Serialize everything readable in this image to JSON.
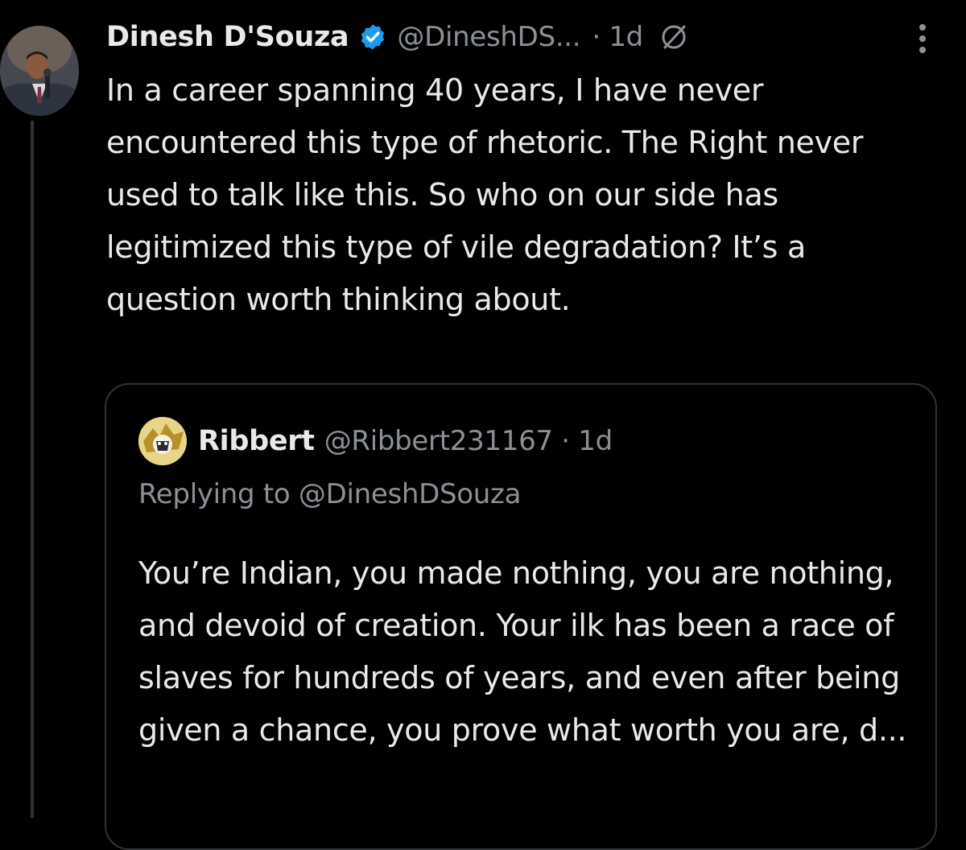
{
  "tweet": {
    "author_name": "Dinesh D'Souza",
    "author_handle": "@DineshDS...",
    "time": "· 1d",
    "icons": {
      "verified": "verified-badge-icon",
      "edited": "edited-icon",
      "more": "more-options-icon"
    },
    "accent_color": "#1d9bf0",
    "text": "In a career spanning 40 years, I have never encountered this type of rhetoric. The Right never used to talk like this. So who on our side has legitimized this type of vile degradation? It’s a question worth thinking about."
  },
  "quoted_tweet": {
    "author_name": "Ribbert",
    "author_handle": "@Ribbert231167 · 1d",
    "replying_to": "Replying to @DineshDSouza",
    "text": "You’re Indian, you made nothing, you are nothing, and devoid of creation. Your ilk has been a race of slaves for hundreds of years, and even after being given a chance, you prove what worth you are, d..."
  }
}
